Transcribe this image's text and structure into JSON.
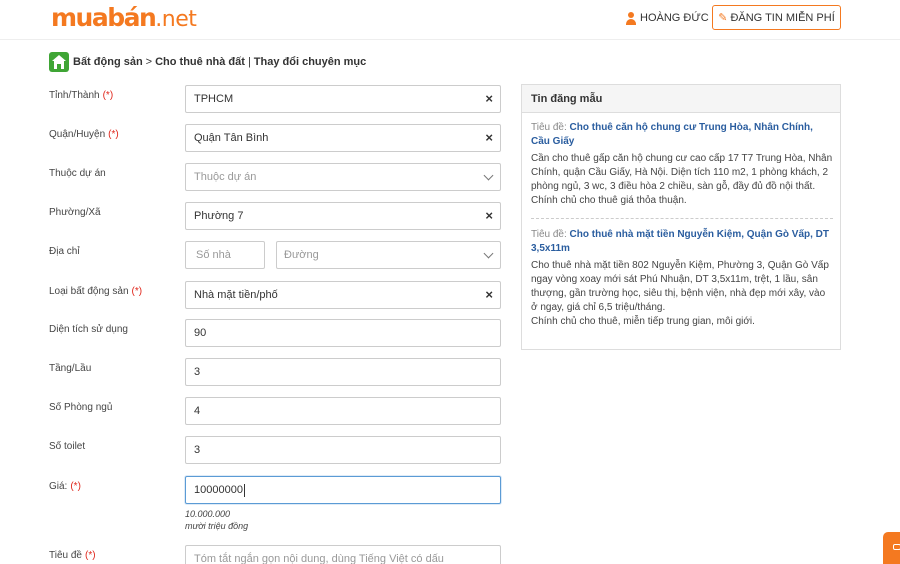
{
  "header": {
    "logo_main": "muabán",
    "logo_tld": ".net",
    "user_name": "HOÀNG ĐỨC",
    "post_button": "ĐĂNG TIN MIỄN PHÍ"
  },
  "breadcrumb": {
    "items": [
      "Bất động sản",
      "Cho thuê nhà đất"
    ],
    "separator_1": ">",
    "separator_2": "|",
    "action": "Thay đổi chuyên mục"
  },
  "form": {
    "required_mark": "(*)",
    "province": {
      "label": "Tỉnh/Thành",
      "value": "TPHCM"
    },
    "district": {
      "label": "Quận/Huyện",
      "value": "Quận Tân Bình"
    },
    "project": {
      "label": "Thuộc dự án",
      "placeholder": "Thuộc dự án"
    },
    "ward": {
      "label": "Phường/Xã",
      "value": "Phường 7"
    },
    "address": {
      "label": "Địa chỉ",
      "house_placeholder": "Số nhà",
      "street_placeholder": "Đường"
    },
    "property_type": {
      "label": "Loại bất động sản",
      "value": "Nhà mặt tiền/phố"
    },
    "area": {
      "label": "Diện tích sử dụng",
      "value": "90"
    },
    "floors": {
      "label": "Tầng/Lầu",
      "value": "3"
    },
    "bedrooms": {
      "label": "Số Phòng ngủ",
      "value": "4"
    },
    "toilets": {
      "label": "Số toilet",
      "value": "3"
    },
    "price": {
      "label": "Giá:",
      "value": "10000000",
      "formatted": "10.000.000",
      "in_words": "mười triệu đồng"
    },
    "title": {
      "label": "Tiêu đề",
      "placeholder": "Tóm tắt ngắn gọn nội dung, dùng Tiếng Việt có dấu"
    }
  },
  "sample_panel": {
    "title": "Tin đăng mẫu",
    "title_prefix": "Tiêu đề:",
    "samples": [
      {
        "title": "Cho thuê căn hộ chung cư Trung Hòa, Nhân Chính, Cầu Giấy",
        "body": "Cần cho thuê gấp căn hộ chung cư cao cấp 17 T7 Trung Hòa, Nhân Chính, quận Cầu Giấy, Hà Nội. Diện tích 110 m2, 1 phòng khách, 2 phòng ngủ, 3 wc, 3 điều hòa 2 chiều, sàn gỗ, đầy đủ đồ nội thất. Chính chủ cho thuê giá thỏa thuận."
      },
      {
        "title": "Cho thuê nhà mặt tiền Nguyễn Kiệm, Quận Gò Vấp, DT 3,5x11m",
        "body": "Cho thuê nhà mặt tiền 802 Nguyễn Kiệm, Phường 3, Quận Gò Vấp ngay vòng xoay mới sát Phú Nhuận, DT 3,5x11m, trệt, 1 lầu, sân thượng, gần trường học, siêu thị, bệnh viện, nhà đẹp mới xây, vào ở ngay, giá chỉ 6,5 triệu/tháng.",
        "body_2": "Chính chủ cho thuê, miễn tiếp trung gian, môi giới."
      }
    ]
  },
  "colors": {
    "brand_orange": "#f47920",
    "link_blue": "#2a5d9f",
    "required_red": "#e0261b",
    "home_green": "#3fa535"
  }
}
